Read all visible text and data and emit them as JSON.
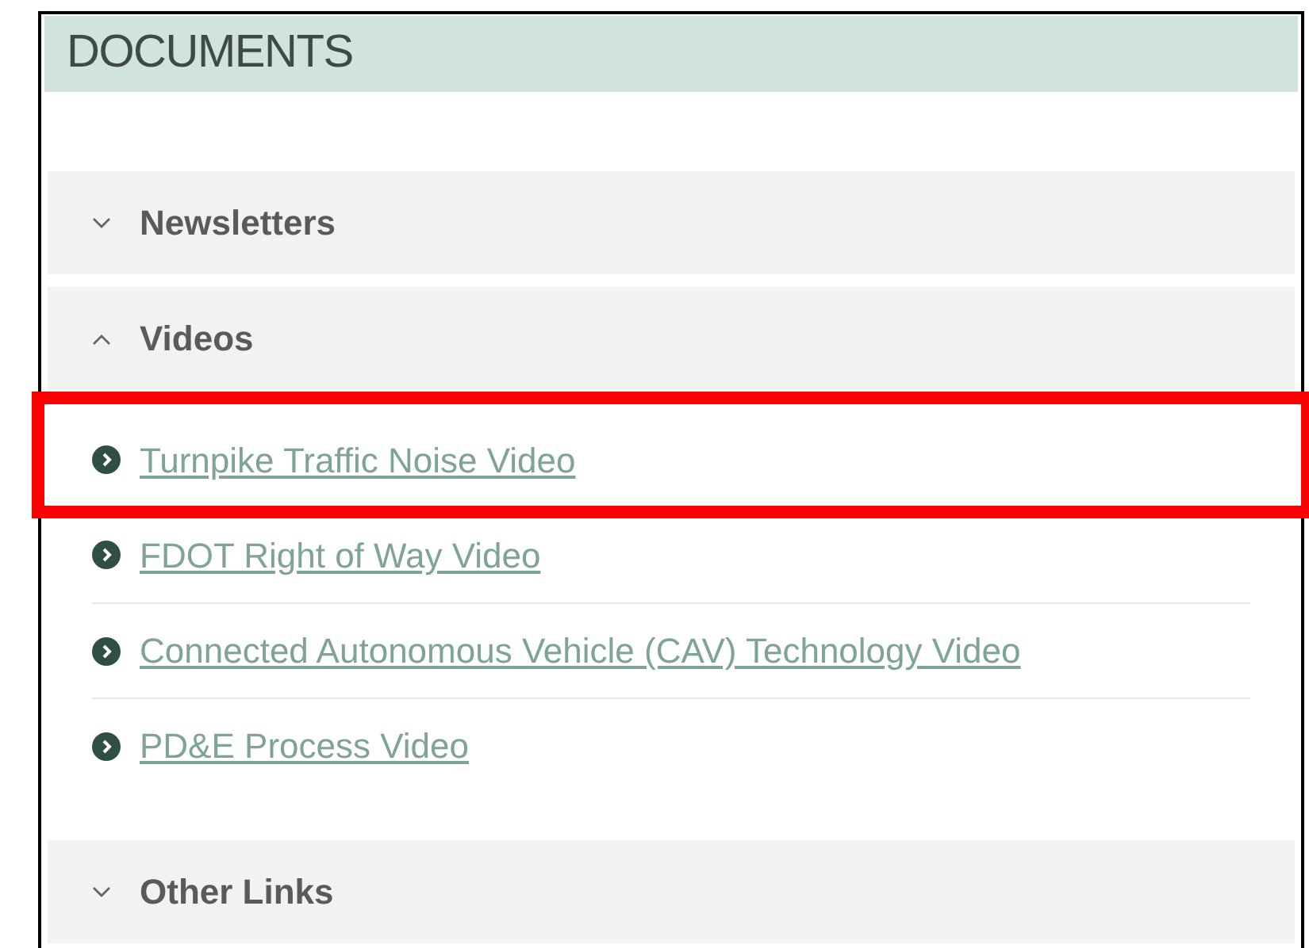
{
  "panel": {
    "title": "DOCUMENTS"
  },
  "sections": [
    {
      "label": "Newsletters",
      "expanded": false
    },
    {
      "label": "Videos",
      "expanded": true,
      "links": [
        {
          "text": "Turnpike Traffic Noise Video",
          "highlighted": true
        },
        {
          "text": "FDOT Right of Way Video",
          "highlighted": false
        },
        {
          "text": "Connected Autonomous Vehicle (CAV) Technology Video",
          "highlighted": false
        },
        {
          "text": "PD&E Process Video",
          "highlighted": false
        }
      ]
    },
    {
      "label": "Other Links",
      "expanded": false
    }
  ]
}
